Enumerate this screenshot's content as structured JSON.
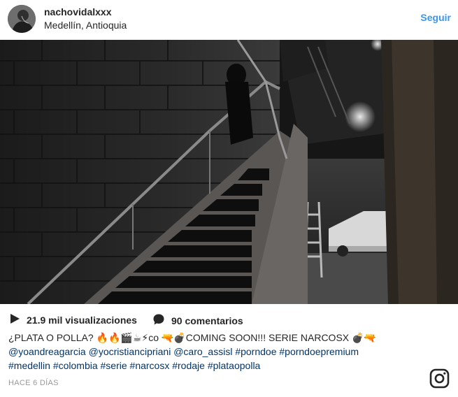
{
  "header": {
    "username": "nachovidalxxx",
    "location": "Medellín, Antioquia",
    "follow_label": "Seguir"
  },
  "media": {
    "type": "video",
    "description_icon": "play-icon"
  },
  "stats": {
    "views": "21.9 mil visualizaciones",
    "comments": "90 comentarios"
  },
  "caption": {
    "line1": "¿PLATA O POLLA? 🔥🔥🎬☕⚡co 🔫💣COMING SOON!!! SERIE NARCOSX 💣🔫",
    "line2": "@yoandreagarcia @yocristiancipriani @caro_assisl #porndoe #porndoepremium",
    "line3": "#medellin #colombia #serie #narcosx #rodaje #plataopolla"
  },
  "timestamp": "HACE 6 DÍAS",
  "colors": {
    "link": "#3897f0",
    "hashtag": "#003569",
    "text": "#262626",
    "muted": "#999999"
  }
}
